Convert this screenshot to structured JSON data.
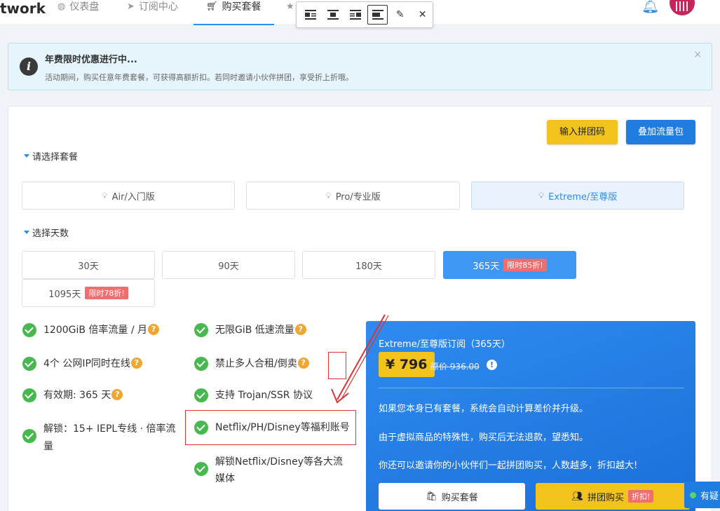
{
  "brand": "twork",
  "nav": {
    "tabs": [
      {
        "icon": "dashboard-icon",
        "label": "仪表盘"
      },
      {
        "icon": "paper-plane-icon",
        "label": "订阅中心"
      },
      {
        "icon": "cart-icon",
        "label": "购买套餐",
        "active": true
      },
      {
        "icon": "star-icon",
        "label": ""
      }
    ]
  },
  "toolbar": {
    "buttons": [
      "align-left-icon",
      "align-center-icon",
      "align-right-icon",
      "align-none-icon",
      "pencil-icon",
      "close-icon"
    ]
  },
  "notice": {
    "title": "年费限时优惠进行中...",
    "text": "活动期间，购买任意年费套餐，可获得高额折扣。若同时邀请小伙伴拼团，享受折上折哦。",
    "close": "×"
  },
  "actions": {
    "group_code": "输入拼团码",
    "add_traffic": "叠加流量包"
  },
  "plans": {
    "label": "请选择套餐",
    "items": [
      {
        "name": "Air/入门版"
      },
      {
        "name": "Pro/专业版"
      },
      {
        "name": "Extreme/至尊版",
        "active": true
      }
    ]
  },
  "days": {
    "label": "选择天数",
    "items": [
      {
        "label": "30天",
        "tag": ""
      },
      {
        "label": "90天",
        "tag": ""
      },
      {
        "label": "180天",
        "tag": ""
      },
      {
        "label": "365天",
        "tag": "限时85折!",
        "active": true
      },
      {
        "label": "1095天",
        "tag": "限时78折!"
      }
    ]
  },
  "features": {
    "left": [
      {
        "text": "1200GiB 倍率流量 / 月",
        "help": "?"
      },
      {
        "text": "4个 公网IP同时在线",
        "help": "?"
      },
      {
        "text": "有效期: 365 天",
        "help": "?"
      },
      {
        "text": "解锁：15+ IEPL专线 · 倍率流量",
        "help": ""
      }
    ],
    "right": [
      {
        "text": "无限GiB 低速流量",
        "help": "?"
      },
      {
        "text": "禁止多人合租/倒卖",
        "help": "?"
      },
      {
        "text": "支持 Trojan/SSR 协议",
        "help": ""
      },
      {
        "text": "Netflix/PH/Disney等福利账号",
        "help": ""
      },
      {
        "text": "解锁Netflix/Disney等各大流媒体",
        "help": ""
      }
    ]
  },
  "summary": {
    "title": "Extreme/至尊版订阅（365天）",
    "price": "¥ 796",
    "original": "原价 936.00",
    "info": "!",
    "lines": [
      "如果您本身已有套餐，系统会自动计算差价并升级。",
      "由于虚拟商品的特殊性，购买后无法退款，望悉知。",
      "你还可以邀请你的小伙伴们一起拼团购买，人数越多，折扣越大!"
    ],
    "buy": "购买套餐",
    "group_buy": "拼团购买",
    "group_tag": "折扣!"
  },
  "chat": {
    "label": "有疑"
  },
  "colors": {
    "accent": "#2b8ef0",
    "yellow": "#f3c31d",
    "check": "#47b84d",
    "tag_red": "#f26d6d",
    "annotation_red": "#d33"
  }
}
